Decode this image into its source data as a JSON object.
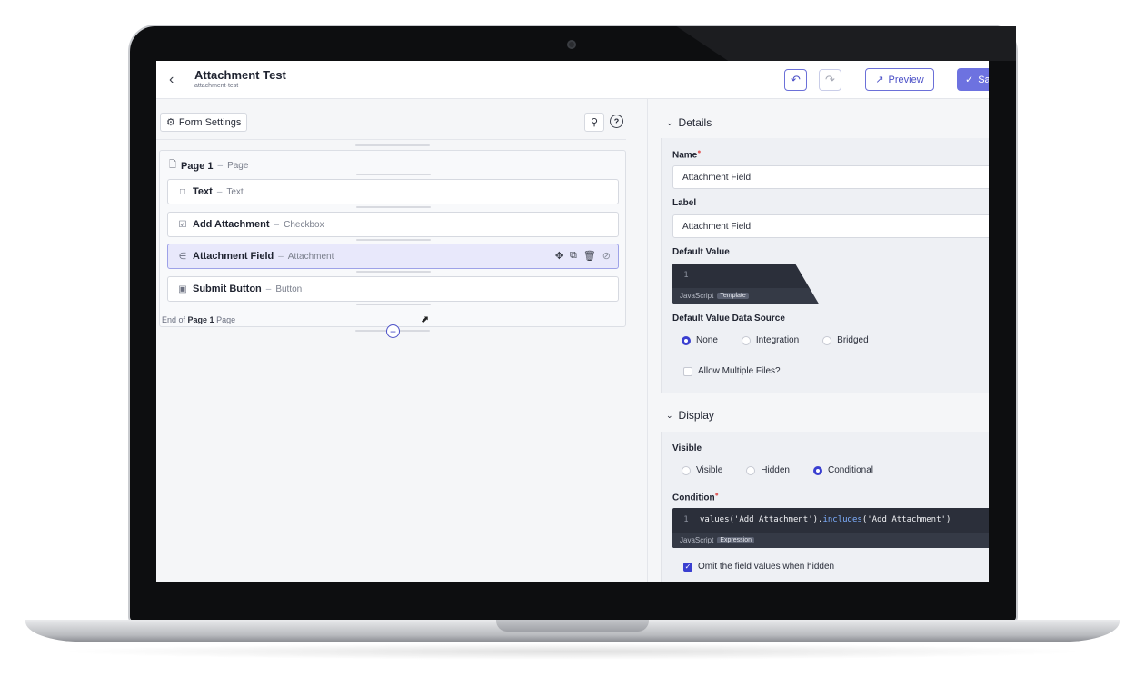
{
  "header": {
    "title": "Attachment Test",
    "slug": "attachment-test",
    "preview_label": "Preview",
    "save_label": "Sa"
  },
  "builder": {
    "form_settings_label": "Form Settings",
    "page": {
      "name": "Page 1",
      "type": "Page",
      "end_prefix": "End of",
      "end_suffix": "Page"
    },
    "fields": [
      {
        "name": "Text",
        "type": "Text",
        "icon": "folder-icon"
      },
      {
        "name": "Add Attachment",
        "type": "Checkbox",
        "icon": "checkbox-icon"
      },
      {
        "name": "Attachment Field",
        "type": "Attachment",
        "icon": "paperclip-icon",
        "selected": true
      },
      {
        "name": "Submit Button",
        "type": "Button",
        "icon": "button-icon"
      }
    ]
  },
  "details": {
    "section_title": "Details",
    "name_label": "Name",
    "name_value": "Attachment Field",
    "label_label": "Label",
    "label_value": "Attachment Field",
    "default_value_label": "Default Value",
    "default_value_line": "1",
    "default_value_lang": "JavaScript",
    "default_value_tag": "Template",
    "data_source_label": "Default Value Data Source",
    "data_source_options": [
      "None",
      "Integration",
      "Bridged"
    ],
    "data_source_selected": "None",
    "allow_multiple_label": "Allow Multiple Files?"
  },
  "display": {
    "section_title": "Display",
    "visible_label": "Visible",
    "visible_options": [
      "Visible",
      "Hidden",
      "Conditional"
    ],
    "visible_selected": "Conditional",
    "condition_label": "Condition",
    "condition_line": "1",
    "condition_code_a": "values('Add Attachment').",
    "condition_code_fn": "includes",
    "condition_code_b": "('Add Attachment')",
    "condition_lang": "JavaScript",
    "condition_tag": "Expression",
    "omit_label": "Omit the field values when hidden"
  },
  "colors": {
    "accent": "#4a4fc7",
    "selected_row": "#e8e8fb",
    "code_bg": "#2b2f3a"
  }
}
